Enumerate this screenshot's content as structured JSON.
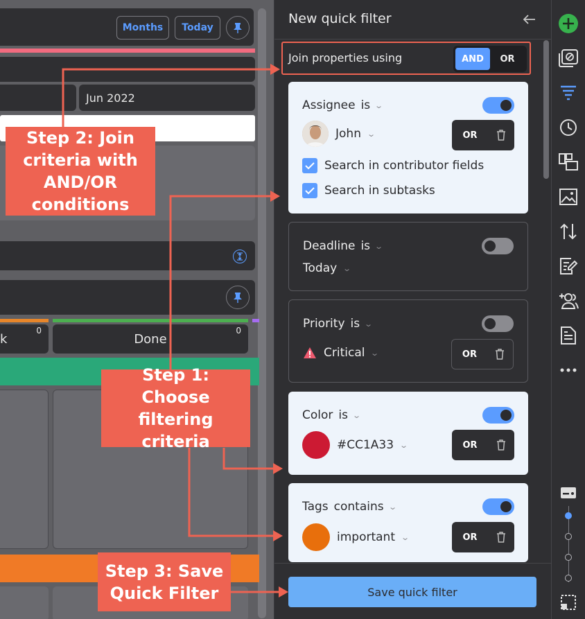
{
  "background_app": {
    "months_label": "Months",
    "today_label": "Today",
    "date_label": "Jun 2022",
    "column_partial_label": "k",
    "column_done_label": "Done",
    "column_partial_count": "0",
    "column_done_count": "0"
  },
  "callouts": {
    "step1": "Step 1: Choose filtering criteria",
    "step2": "Step 2: Join criteria with AND/OR conditions",
    "step3": "Step 3: Save Quick Filter"
  },
  "panel": {
    "title": "New quick filter",
    "join_label": "Join properties using",
    "and_label": "AND",
    "or_label": "OR",
    "save_label": "Save quick filter"
  },
  "criteria": [
    {
      "property": "Assignee",
      "operator": "is",
      "value": "John",
      "enabled": true,
      "or_label": "OR",
      "options": [
        "Search in contributor fields",
        "Search in subtasks"
      ]
    },
    {
      "property": "Deadline",
      "operator": "is",
      "value": "Today",
      "enabled": false
    },
    {
      "property": "Priority",
      "operator": "is",
      "value": "Critical",
      "enabled": false,
      "or_label": "OR"
    },
    {
      "property": "Color",
      "operator": "is",
      "value": "#CC1A33",
      "enabled": true,
      "or_label": "OR",
      "swatch": "#cc1a33"
    },
    {
      "property": "Tags",
      "operator": "contains",
      "value": "important",
      "enabled": true,
      "or_label": "OR",
      "swatch": "#e86f0c"
    }
  ],
  "toolbar_icons": [
    "add-icon",
    "archive-icon",
    "filter-icon",
    "clock-icon",
    "board-icon",
    "image-icon",
    "sort-icon",
    "edit-icon",
    "add-user-icon",
    "document-icon",
    "more-icon",
    "card-view-icon",
    "selection-icon"
  ],
  "colors": {
    "accent": "#5b9cff",
    "callout": "#ee6352",
    "save": "#6aaef7"
  }
}
